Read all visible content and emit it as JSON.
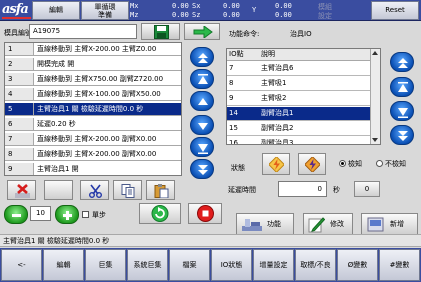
{
  "top": {
    "logo": "asfa",
    "edit": "編輯",
    "mode_line1": "單循環",
    "mode_line2": "準備",
    "coords": [
      {
        "axis": "Mx",
        "value": "0.00"
      },
      {
        "axis": "Sx",
        "value": "0.00"
      },
      {
        "axis": "Y",
        "value": "0.00"
      },
      {
        "axis": "Mz",
        "value": "0.00"
      },
      {
        "axis": "Sz",
        "value": "0.00"
      },
      {
        "axis": "",
        "value": "0.00"
      }
    ],
    "dim_label": "模組",
    "dim_sub": "設定",
    "reset": "Reset"
  },
  "program": {
    "name_label": "模具編號",
    "name_value": "A19075",
    "rows": [
      {
        "num": "1",
        "text": "直線移動到 主臂X-200.00 主臂Z0.00"
      },
      {
        "num": "2",
        "text": "開模完成 開"
      },
      {
        "num": "3",
        "text": "直線移動到 主臂X750.00 副臂Z720.00"
      },
      {
        "num": "4",
        "text": "直線移動到 主臂X-100.00 副臂X50.00"
      },
      {
        "num": "5",
        "text": "主臂治具1 關 檢驗延遲時間0.0 秒"
      },
      {
        "num": "6",
        "text": "延遲0.20 秒"
      },
      {
        "num": "7",
        "text": "直線移動到 主臂X-200.00 副臂X0.00"
      },
      {
        "num": "8",
        "text": "直線移動到 主臂X-200.00 副臂X0.00"
      },
      {
        "num": "9",
        "text": "主臂治具1 開"
      }
    ],
    "selected_index": 4,
    "step": "10",
    "single_step_label": "單步"
  },
  "function": {
    "label": "功能命令:",
    "value": "治具IO",
    "col_num": "IO點",
    "col_desc": "說明",
    "rows": [
      {
        "num": "7",
        "desc": "主臂治具6"
      },
      {
        "num": "8",
        "desc": "主臂吸1"
      },
      {
        "num": "9",
        "desc": "主臂吸2"
      },
      {
        "num": "14",
        "desc": "副臂治具1"
      },
      {
        "num": "15",
        "desc": "副臂治具2"
      },
      {
        "num": "16",
        "desc": "副臂治具3"
      }
    ],
    "selected_index": 3,
    "state_label": "狀態",
    "detect": "檢知",
    "no_detect": "不檢知",
    "delay_label": "延遲時間",
    "delay_value": "0",
    "delay_unit": "秒",
    "delay_zero": "0",
    "func_btn": "功能",
    "modify_btn": "修改",
    "add_btn": "新增"
  },
  "status_text": "主臂治具1 關 檢驗延遲時間0.0 秒",
  "menu": [
    "<-",
    "編輯",
    "巨集",
    "系統巨集",
    "檔案",
    "IO狀態",
    "增量設定",
    "取標/不良",
    "Ø變數",
    "#變數"
  ]
}
